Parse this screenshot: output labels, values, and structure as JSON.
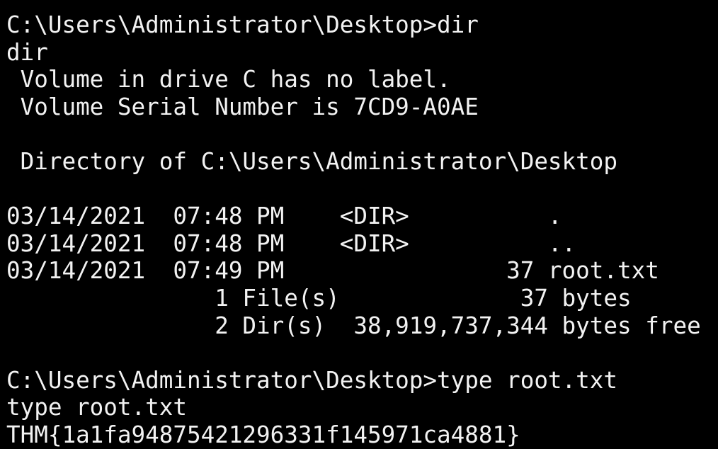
{
  "terminal": {
    "lines": [
      "C:\\Users\\Administrator\\Desktop>dir",
      "dir",
      " Volume in drive C has no label.",
      " Volume Serial Number is 7CD9-A0AE",
      "",
      " Directory of C:\\Users\\Administrator\\Desktop",
      "",
      "03/14/2021  07:48 PM    <DIR>          .",
      "03/14/2021  07:48 PM    <DIR>          ..",
      "03/14/2021  07:49 PM                37 root.txt",
      "               1 File(s)             37 bytes",
      "               2 Dir(s)  38,919,737,344 bytes free",
      "",
      "C:\\Users\\Administrator\\Desktop>type root.txt",
      "type root.txt",
      "THM{1a1fa94875421296331f145971ca4881}"
    ],
    "colors": {
      "background": "#000000",
      "foreground": "#f2f2f2"
    }
  }
}
